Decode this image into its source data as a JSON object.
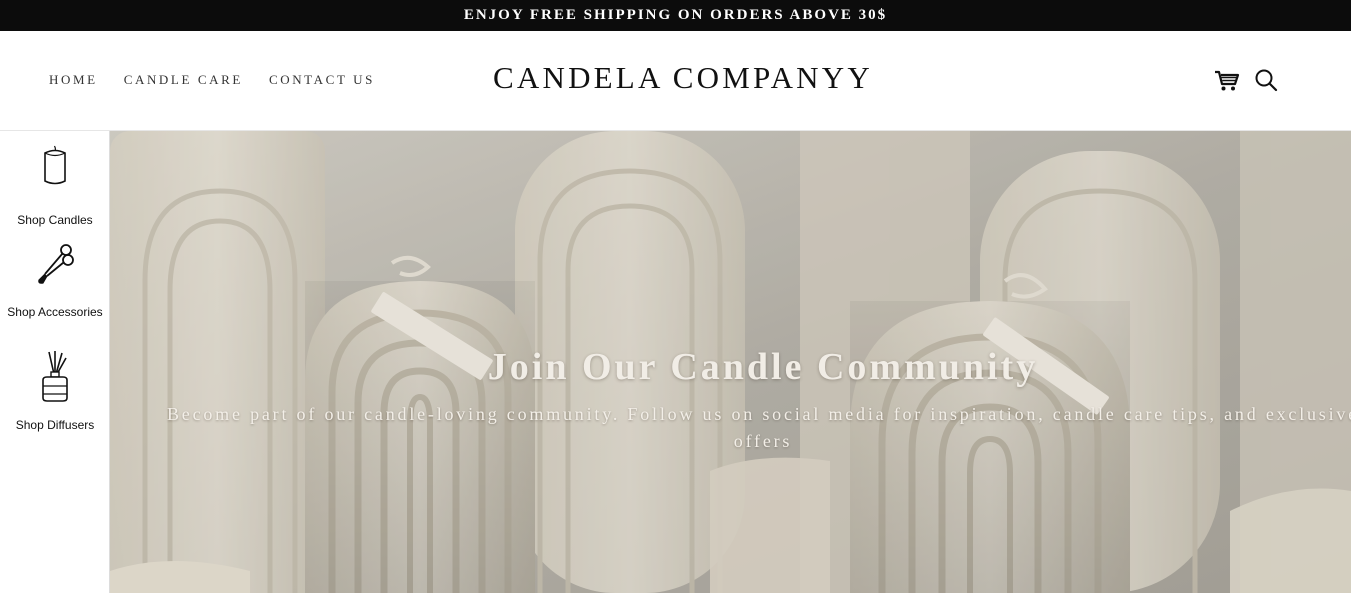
{
  "announcement": {
    "text": "ENJOY FREE SHIPPING ON ORDERS ABOVE 30$"
  },
  "header": {
    "nav": [
      {
        "label": "HOME"
      },
      {
        "label": "CANDLE CARE"
      },
      {
        "label": "CONTACT US"
      }
    ],
    "brand": "CANDELA COMPANYY",
    "icons": [
      "cart-icon",
      "search-icon"
    ]
  },
  "sidebar": {
    "items": [
      {
        "label": "Shop Candles",
        "icon": "candle-icon"
      },
      {
        "label": "Shop Accessories",
        "icon": "wick-trimmer-icon"
      },
      {
        "label": "Shop Diffusers",
        "icon": "reed-diffuser-icon"
      }
    ]
  },
  "hero": {
    "title": "Join Our Candle Community",
    "subtitle": "Become part of our candle-loving community. Follow us on social media for inspiration, candle care tips, and exclusive offers",
    "image": "arch-candles-photo"
  },
  "colors": {
    "announcement_bg": "#0c0c0c",
    "hero_text": "#f1ede6",
    "candle": "#f2ede0"
  }
}
